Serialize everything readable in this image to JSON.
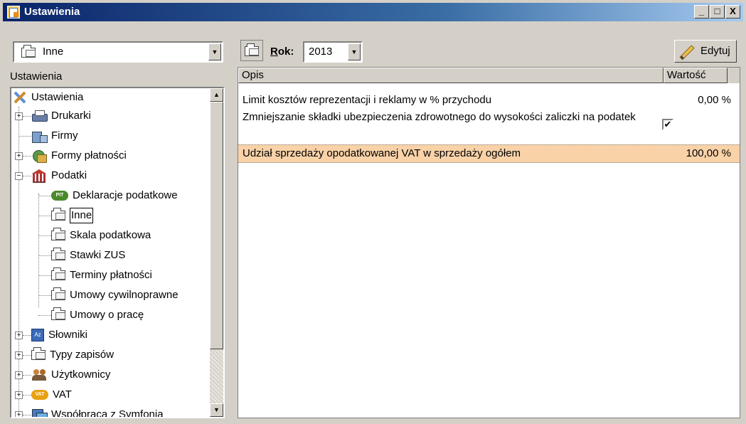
{
  "window": {
    "title": "Ustawienia",
    "controls": [
      "_",
      "□",
      "X"
    ]
  },
  "left": {
    "combo_value": "Inne",
    "section_label": "Ustawienia",
    "tree": [
      {
        "label": "Ustawienia",
        "icon": "tools-icon"
      },
      {
        "label": "Drukarki",
        "icon": "printer-icon"
      },
      {
        "label": "Firmy",
        "icon": "company-icon"
      },
      {
        "label": "Formy płatności",
        "icon": "payment-icon"
      },
      {
        "label": "Podatki",
        "icon": "tax-office-icon"
      },
      {
        "label": "Deklaracje podatkowe",
        "icon": "pit-icon"
      },
      {
        "label": "Inne",
        "icon": "folder-icon"
      },
      {
        "label": "Skala podatkowa",
        "icon": "folder-icon"
      },
      {
        "label": "Stawki ZUS",
        "icon": "folder-icon"
      },
      {
        "label": "Terminy płatności",
        "icon": "folder-icon"
      },
      {
        "label": "Umowy cywilnoprawne",
        "icon": "folder-icon"
      },
      {
        "label": "Umowy o pracę",
        "icon": "folder-icon"
      },
      {
        "label": "Słowniki",
        "icon": "dictionary-icon"
      },
      {
        "label": "Typy zapisów",
        "icon": "folder-icon"
      },
      {
        "label": "Użytkownicy",
        "icon": "users-icon"
      },
      {
        "label": "VAT",
        "icon": "vat-icon"
      },
      {
        "label": "Współpraca z Symfonią",
        "icon": "sync-icon"
      }
    ],
    "icon_texts": {
      "pit": "PIT",
      "vat": "VAT",
      "dict": "Az"
    }
  },
  "right": {
    "year_label_first": "R",
    "year_label_rest": "ok:",
    "year_value": "2013",
    "edit_label": "Edytuj",
    "columns": [
      "Opis",
      "Wartość"
    ],
    "rows": [
      {
        "desc": "Limit kosztów reprezentacji i reklamy w % przychodu",
        "value": "0,00 %"
      },
      {
        "desc": "Zmniejszanie składki ubezpieczenia zdrowotnego do wysokości zaliczki na podatek",
        "value": "✔"
      },
      {
        "desc": "Udział sprzedaży opodatkowanej VAT w sprzedaży ogółem",
        "value": "100,00 %"
      }
    ]
  },
  "colors": {
    "title_start": "#0a246a",
    "highlight_row": "#f9d2a8",
    "face": "#d4d0c8"
  }
}
